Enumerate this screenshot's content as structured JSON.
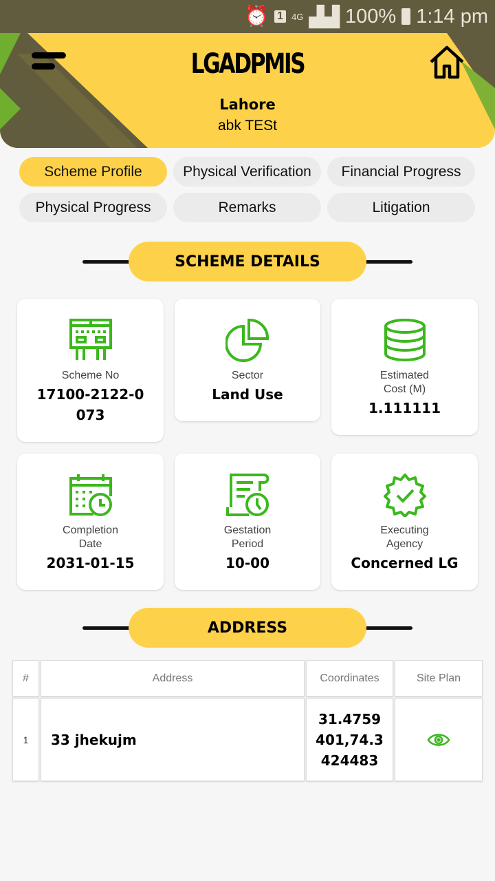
{
  "status_bar": {
    "battery": "100%",
    "time": "1:14 pm",
    "network": "4G",
    "sim": "1"
  },
  "header": {
    "title": "LGADPMIS",
    "city": "Lahore",
    "user": "abk TESt"
  },
  "tabs": [
    {
      "label": "Scheme Profile",
      "active": true
    },
    {
      "label": "Physical Verification"
    },
    {
      "label": "Financial Progress"
    },
    {
      "label": "Physical Progress"
    },
    {
      "label": "Remarks"
    },
    {
      "label": "Litigation"
    }
  ],
  "scheme_details": {
    "title": "SCHEME DETAILS",
    "cards": [
      {
        "label": "Scheme No",
        "value": "17100-2122-0073",
        "icon": "board-icon"
      },
      {
        "label": "Sector",
        "value": "Land Use",
        "icon": "pie-chart-icon"
      },
      {
        "label": "Estimated Cost (M)",
        "value": "1.111111",
        "icon": "coins-icon"
      },
      {
        "label": "Completion Date",
        "value": "2031-01-15",
        "icon": "calendar-clock-icon"
      },
      {
        "label": "Gestation Period",
        "value": "10-00",
        "icon": "document-clock-icon"
      },
      {
        "label": "Executing Agency",
        "value": "Concerned LG",
        "icon": "verified-badge-icon"
      }
    ]
  },
  "address": {
    "title": "ADDRESS",
    "columns": [
      "#",
      "Address",
      "Coordinates",
      "Site Plan"
    ],
    "rows": [
      {
        "num": "1",
        "address": "33 jhekujm",
        "coordinates": "31.4759401,74.3424483",
        "site_plan": "eye-icon"
      }
    ]
  },
  "colors": {
    "accent": "#fdd24a",
    "icon_green": "#3cb81e",
    "status_bar": "#625c3e"
  }
}
